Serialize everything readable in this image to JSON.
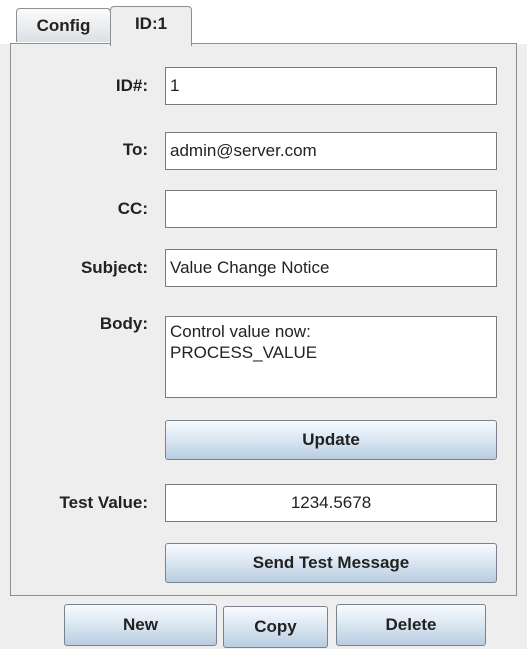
{
  "tabs": [
    {
      "label": "Config"
    },
    {
      "label": "ID:1"
    }
  ],
  "form": {
    "id_label": "ID#:",
    "id_value": "1",
    "to_label": "To:",
    "to_value": "admin@server.com",
    "cc_label": "CC:",
    "cc_value": "",
    "subject_label": "Subject:",
    "subject_value": "Value Change Notice",
    "body_label": "Body:",
    "body_value": "Control value now:\nPROCESS_VALUE",
    "update_label": "Update",
    "test_value_label": "Test Value:",
    "test_value": "1234.5678",
    "send_test_label": "Send Test Message"
  },
  "actions": {
    "new_label": "New",
    "copy_label": "Copy",
    "delete_label": "Delete"
  }
}
